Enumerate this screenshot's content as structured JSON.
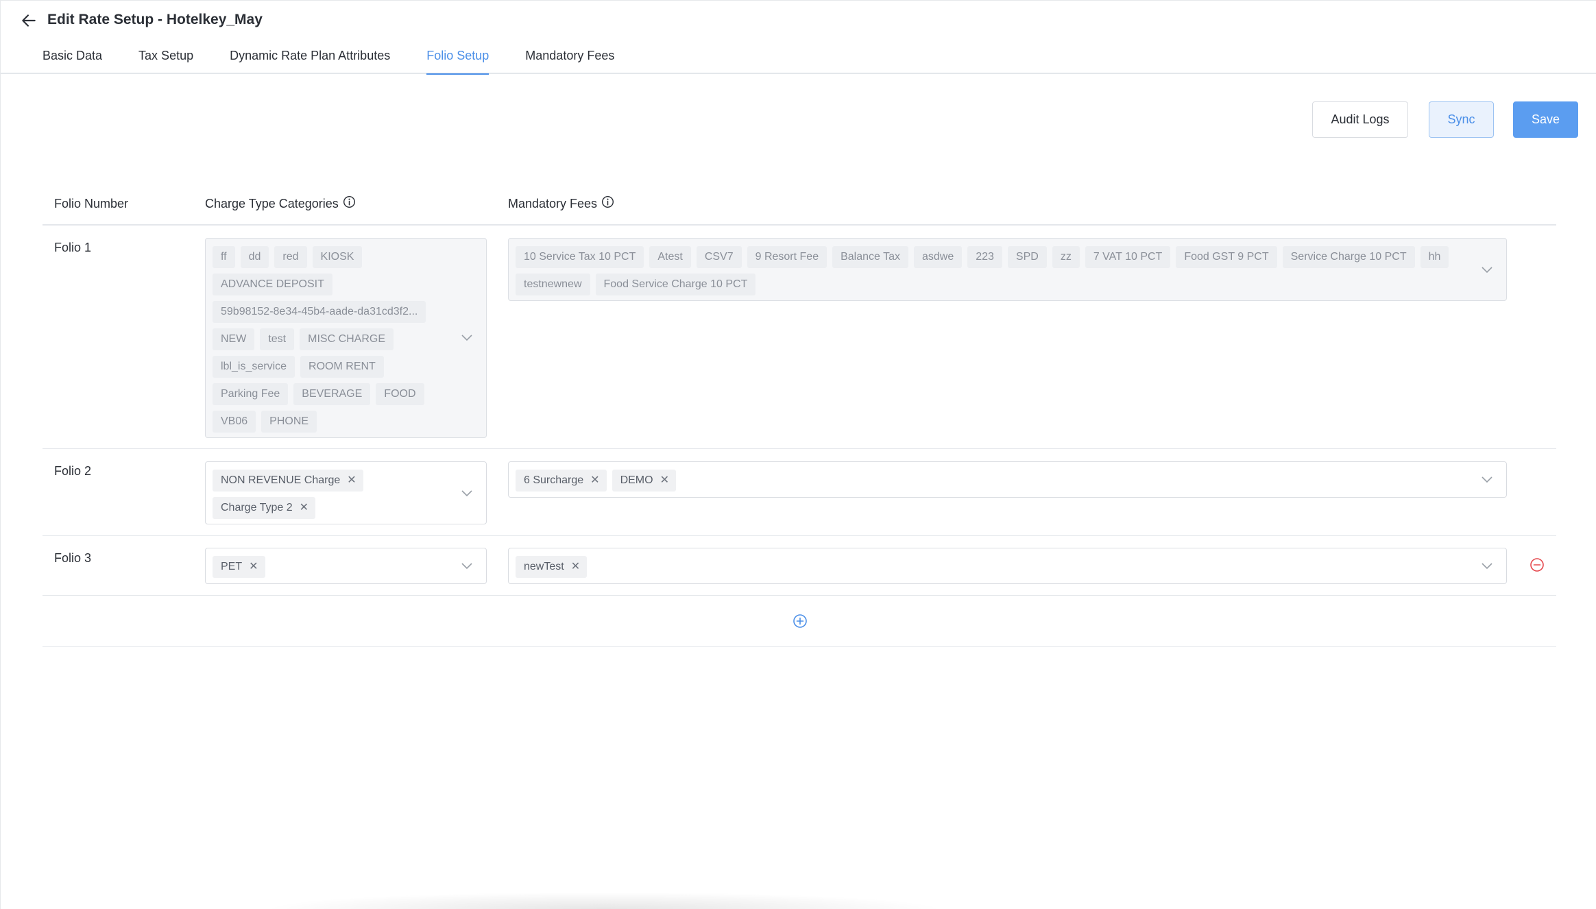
{
  "header": {
    "title": "Edit Rate Setup - Hotelkey_May",
    "tabs": [
      {
        "label": "Basic Data"
      },
      {
        "label": "Tax Setup"
      },
      {
        "label": "Dynamic Rate Plan Attributes"
      },
      {
        "label": "Folio Setup"
      },
      {
        "label": "Mandatory Fees"
      }
    ],
    "active_tab": "Folio Setup"
  },
  "actions": {
    "audit_label": "Audit Logs",
    "sync_label": "Sync",
    "save_label": "Save"
  },
  "table": {
    "columns": {
      "folio": "Folio Number",
      "charge_types": "Charge Type Categories",
      "fees": "Mandatory Fees"
    },
    "rows": [
      {
        "label": "Folio 1",
        "charge_types": [
          "ff",
          "dd",
          "red",
          "KIOSK",
          "ADVANCE DEPOSIT",
          "59b98152-8e34-45b4-aade-da31cd3f2...",
          "NEW",
          "test",
          "MISC CHARGE",
          "lbl_is_service",
          "ROOM RENT",
          "Parking Fee",
          "BEVERAGE",
          "FOOD",
          "VB06",
          "PHONE"
        ],
        "fees": [
          "10 Service Tax 10 PCT",
          "Atest",
          "CSV7",
          "9 Resort Fee",
          "Balance Tax",
          "asdwe",
          "223",
          "SPD",
          "zz",
          "7 VAT 10 PCT",
          "Food GST 9 PCT",
          "Service Charge 10 PCT",
          "hh",
          "testnewnew",
          "Food Service Charge 10 PCT"
        ]
      },
      {
        "label": "Folio 2",
        "charge_types": [
          "NON REVENUE Charge",
          "Charge Type 2"
        ],
        "fees": [
          "6 Surcharge",
          "DEMO"
        ]
      },
      {
        "label": "Folio 3",
        "charge_types": [
          "PET"
        ],
        "fees": [
          "newTest"
        ]
      }
    ]
  },
  "colors": {
    "accent": "#4b8fe8",
    "save_bg": "#5b9df0",
    "remove": "#e5484d"
  }
}
